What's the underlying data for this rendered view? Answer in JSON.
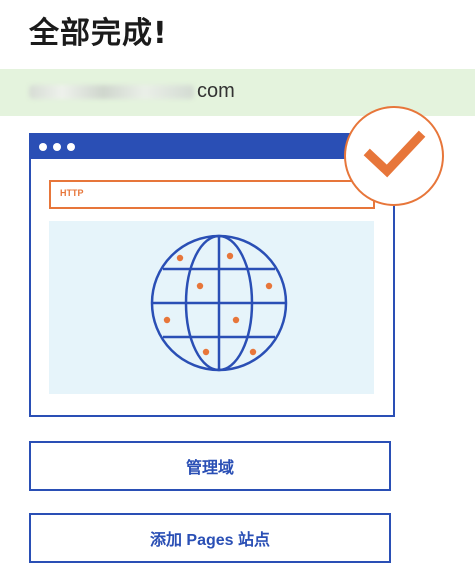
{
  "page": {
    "title": "全部完成!",
    "domain_suffix": "com"
  },
  "illustration": {
    "url_label": "HTTP",
    "colors": {
      "primary": "#2a4fb5",
      "accent": "#e7763a",
      "content_bg": "#e6f4fa",
      "banner_bg": "#e4f3dd"
    },
    "icons": [
      "browser-window",
      "globe-icon",
      "checkmark-icon"
    ]
  },
  "actions": {
    "manage_domain_label": "管理域",
    "add_pages_site_label": "添加 Pages 站点"
  }
}
